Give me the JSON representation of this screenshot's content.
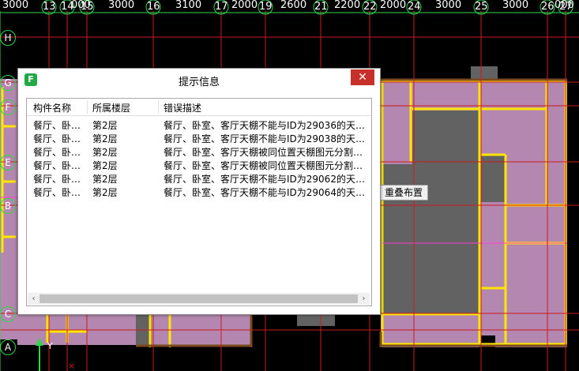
{
  "cad": {
    "column_axes": [
      "13",
      "14",
      "15",
      "16",
      "17",
      "19",
      "21",
      "22",
      "24",
      "25",
      "26",
      "27"
    ],
    "column_dimensions": [
      "3000",
      "3000",
      "000",
      "3000",
      "3100",
      "2000",
      "2600",
      "2200",
      "2000",
      "3000",
      "3000",
      "000"
    ],
    "row_axes": [
      "H",
      "G",
      "F",
      "E",
      "B",
      "C",
      "A"
    ],
    "tooltip": "重叠布置",
    "axis_y_label": "Y"
  },
  "dialog": {
    "app_icon": "F",
    "title": "提示信息",
    "close_symbol": "✕",
    "columns": [
      "构件名称",
      "所属楼层",
      "错误描述"
    ],
    "rows": [
      {
        "name": "餐厅、卧…",
        "floor": "第2层",
        "desc": "餐厅、卧室、客厅天棚不能与ID为29036的天…"
      },
      {
        "name": "餐厅、卧…",
        "floor": "第2层",
        "desc": "餐厅、卧室、客厅天棚不能与ID为29038的天…"
      },
      {
        "name": "餐厅、卧…",
        "floor": "第2层",
        "desc": "餐厅、卧室、客厅天棚被同位置天棚图元分割…"
      },
      {
        "name": "餐厅、卧…",
        "floor": "第2层",
        "desc": "餐厅、卧室、客厅天棚被同位置天棚图元分割…"
      },
      {
        "name": "餐厅、卧…",
        "floor": "第2层",
        "desc": "餐厅、卧室、客厅天棚不能与ID为29062的天…"
      },
      {
        "name": "餐厅、卧…",
        "floor": "第2层",
        "desc": "餐厅、卧室、客厅天棚不能与ID为29064的天…"
      }
    ],
    "scroll_left": "‹",
    "scroll_right": "›"
  },
  "colors": {
    "room_fill": "#b487b0",
    "wall": "#ffe600",
    "grid": "#d01a1a",
    "axis": "#2fd64a",
    "dark_room": "#626262"
  }
}
